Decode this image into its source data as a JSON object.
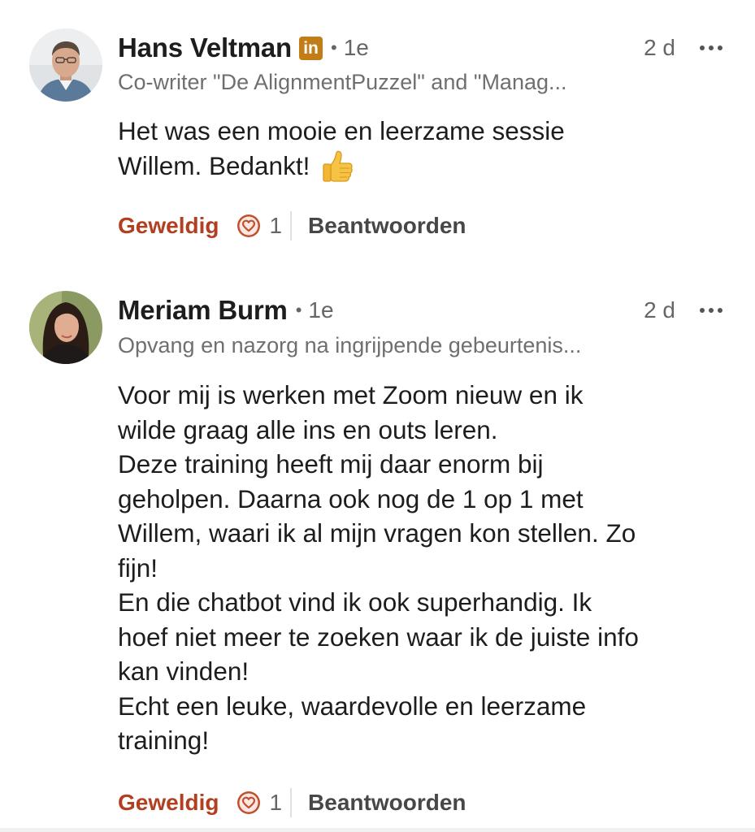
{
  "comments": [
    {
      "author": "Hans Veltman",
      "has_linkedin_badge": true,
      "badge_label": "in",
      "degree": "1e",
      "time": "2 d",
      "headline": "Co-writer \"De AlignmentPuzzel\" and \"Manag...",
      "body": [
        "Het was een mooie en leerzame sessie",
        "Willem. Bedankt!"
      ],
      "emoji": "thumbs-up",
      "reaction_label": "Geweldig",
      "reaction_icon": "heart-icon",
      "reaction_count": "1",
      "reply_label": "Beantwoorden"
    },
    {
      "author": "Meriam Burm",
      "has_linkedin_badge": false,
      "degree": "1e",
      "time": "2 d",
      "headline": "Opvang en nazorg na ingrijpende gebeurtenis...",
      "body": [
        "Voor mij is werken met Zoom nieuw en ik",
        "wilde graag alle ins en outs leren.",
        "Deze training heeft mij daar enorm bij",
        "geholpen. Daarna ook nog de 1 op 1 met",
        "Willem, waari ik al mijn vragen kon stellen. Zo",
        "fijn!",
        "En die chatbot vind ik ook superhandig. Ik",
        "hoef niet meer te zoeken waar ik de juiste info",
        "kan vinden!",
        "Echt een leuke, waardevolle en leerzame",
        "training!"
      ],
      "reaction_label": "Geweldig",
      "reaction_icon": "heart-icon",
      "reaction_count": "1",
      "reply_label": "Beantwoorden"
    }
  ],
  "colors": {
    "reaction_accent": "#b24020",
    "badge_brand": "#c37d16",
    "secondary_text": "#666666",
    "primary_text": "#1d1d1d"
  }
}
